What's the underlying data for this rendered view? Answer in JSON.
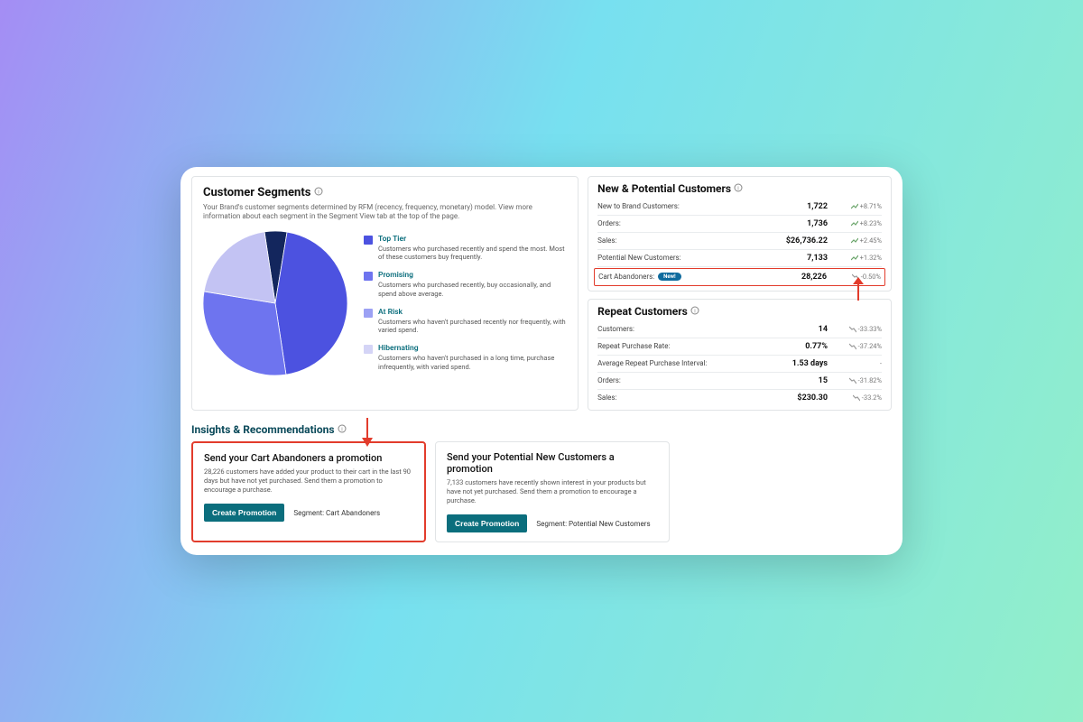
{
  "chart_data": {
    "type": "pie",
    "title": "Customer Segments",
    "series": [
      {
        "name": "Top Tier",
        "value": 5,
        "color": "#13265d"
      },
      {
        "name": "Promising",
        "value": 45,
        "color": "#4c52e0"
      },
      {
        "name": "At Risk",
        "value": 30,
        "color": "#6e74ef"
      },
      {
        "name": "Hibernating",
        "value": 20,
        "color": "#c3c3f3"
      }
    ]
  },
  "segments": {
    "title": "Customer Segments",
    "desc": "Your Brand's customer segments determined by RFM (recency, frequency, monetary) model. View more information about each segment in the Segment View tab at the top of the page.",
    "items": [
      {
        "name": "Top Tier",
        "color": "#4c52e0",
        "desc": "Customers who purchased recently and spend the most. Most of these customers buy frequently."
      },
      {
        "name": "Promising",
        "color": "#6e74ef",
        "desc": "Customers who purchased recently, buy occasionally, and spend above average."
      },
      {
        "name": "At Risk",
        "color": "#9ca1f4",
        "desc": "Customers who haven't purchased recently nor frequently, with varied spend."
      },
      {
        "name": "Hibernating",
        "color": "#d4d4f6",
        "desc": "Customers who haven't purchased in a long time, purchase infrequently, with varied spend."
      }
    ]
  },
  "newcust": {
    "title": "New & Potential Customers",
    "rows": [
      {
        "label": "New to Brand Customers:",
        "value": "1,722",
        "delta": "+8.71%",
        "dir": "up"
      },
      {
        "label": "Orders:",
        "value": "1,736",
        "delta": "+8.23%",
        "dir": "up"
      },
      {
        "label": "Sales:",
        "value": "$26,736.22",
        "delta": "+2.45%",
        "dir": "up"
      },
      {
        "label": "Potential New Customers:",
        "value": "7,133",
        "delta": "+1.32%",
        "dir": "up"
      },
      {
        "label": "Cart Abandoners:",
        "value": "28,226",
        "delta": "-0.50%",
        "dir": "down",
        "badge": "New!",
        "highlight": true
      }
    ]
  },
  "repeat": {
    "title": "Repeat Customers",
    "rows": [
      {
        "label": "Customers:",
        "value": "14",
        "delta": "-33.33%",
        "dir": "down"
      },
      {
        "label": "Repeat Purchase Rate:",
        "value": "0.77%",
        "delta": "-37.24%",
        "dir": "down"
      },
      {
        "label": "Average Repeat Purchase Interval:",
        "value": "1.53 days",
        "delta": "-",
        "dir": "none"
      },
      {
        "label": "Orders:",
        "value": "15",
        "delta": "-31.82%",
        "dir": "down"
      },
      {
        "label": "Sales:",
        "value": "$230.30",
        "delta": "-33.2%",
        "dir": "down"
      }
    ]
  },
  "insights": {
    "title": "Insights & Recommendations",
    "cards": [
      {
        "title": "Send your Cart Abandoners a promotion",
        "desc": "28,226 customers have added your product to their cart in the last 90 days but have not yet purchased. Send them a promotion to encourage a purchase.",
        "cta": "Create Promotion",
        "segment": "Segment: Cart Abandoners",
        "red": true
      },
      {
        "title": "Send your Potential New Customers a promotion",
        "desc": "7,133 customers have recently shown interest in your products but have not yet purchased. Send them a promotion to encourage a purchase.",
        "cta": "Create Promotion",
        "segment": "Segment: Potential New Customers",
        "red": false
      }
    ]
  }
}
